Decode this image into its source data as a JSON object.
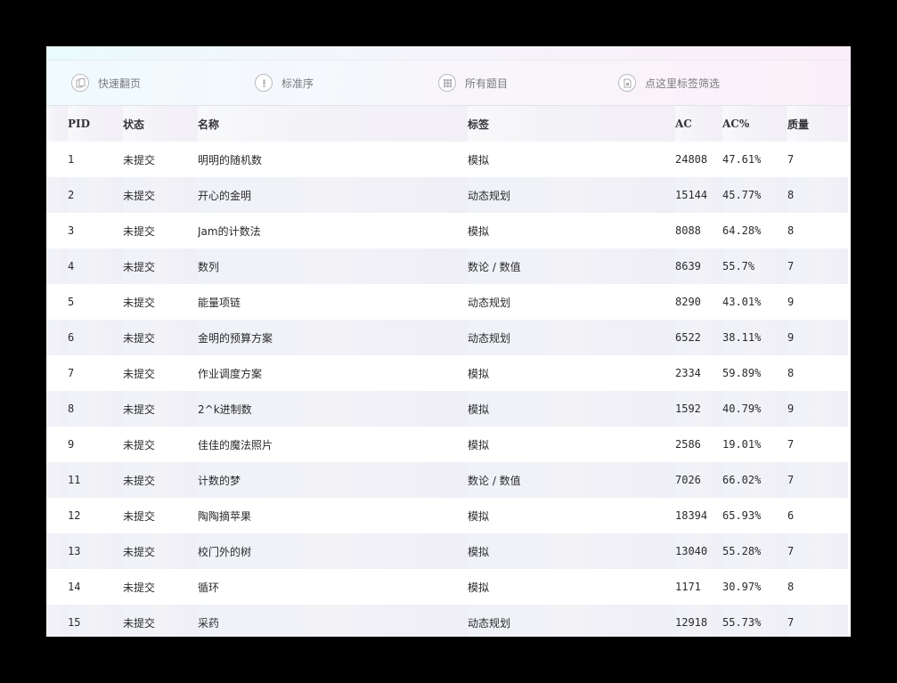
{
  "toolbar": {
    "items": [
      {
        "label": "快速翻页",
        "icon": "pages-icon"
      },
      {
        "label": "标准序",
        "icon": "info-icon"
      },
      {
        "label": "所有题目",
        "icon": "grid-icon"
      },
      {
        "label": "点这里标签筛选",
        "icon": "tag-icon"
      }
    ]
  },
  "table": {
    "headers": [
      "PID",
      "状态",
      "名称",
      "标签",
      "AC",
      "AC%",
      "质量"
    ],
    "rows": [
      {
        "pid": "1",
        "status": "未提交",
        "name": "明明的随机数",
        "tag": "模拟",
        "ac": "24808",
        "acp": "47.61%",
        "quality": "7"
      },
      {
        "pid": "2",
        "status": "未提交",
        "name": "开心的金明",
        "tag": "动态规划",
        "ac": "15144",
        "acp": "45.77%",
        "quality": "8"
      },
      {
        "pid": "3",
        "status": "未提交",
        "name": "Jam的计数法",
        "tag": "模拟",
        "ac": "8088",
        "acp": "64.28%",
        "quality": "8"
      },
      {
        "pid": "4",
        "status": "未提交",
        "name": "数列",
        "tag": "数论 / 数值",
        "ac": "8639",
        "acp": "55.7%",
        "quality": "7"
      },
      {
        "pid": "5",
        "status": "未提交",
        "name": "能量项链",
        "tag": "动态规划",
        "ac": "8290",
        "acp": "43.01%",
        "quality": "9"
      },
      {
        "pid": "6",
        "status": "未提交",
        "name": "金明的预算方案",
        "tag": "动态规划",
        "ac": "6522",
        "acp": "38.11%",
        "quality": "9"
      },
      {
        "pid": "7",
        "status": "未提交",
        "name": "作业调度方案",
        "tag": "模拟",
        "ac": "2334",
        "acp": "59.89%",
        "quality": "8"
      },
      {
        "pid": "8",
        "status": "未提交",
        "name": "2^k进制数",
        "tag": "模拟",
        "ac": "1592",
        "acp": "40.79%",
        "quality": "9"
      },
      {
        "pid": "9",
        "status": "未提交",
        "name": "佳佳的魔法照片",
        "tag": "模拟",
        "ac": "2586",
        "acp": "19.01%",
        "quality": "7"
      },
      {
        "pid": "11",
        "status": "未提交",
        "name": "计数的梦",
        "tag": "数论 / 数值",
        "ac": "7026",
        "acp": "66.02%",
        "quality": "7"
      },
      {
        "pid": "12",
        "status": "未提交",
        "name": "陶陶摘苹果",
        "tag": "模拟",
        "ac": "18394",
        "acp": "65.93%",
        "quality": "6"
      },
      {
        "pid": "13",
        "status": "未提交",
        "name": "校门外的树",
        "tag": "模拟",
        "ac": "13040",
        "acp": "55.28%",
        "quality": "7"
      },
      {
        "pid": "14",
        "status": "未提交",
        "name": "循环",
        "tag": "模拟",
        "ac": "1171",
        "acp": "30.97%",
        "quality": "8"
      },
      {
        "pid": "15",
        "status": "未提交",
        "name": "采药",
        "tag": "动态规划",
        "ac": "12918",
        "acp": "55.73%",
        "quality": "7"
      }
    ]
  }
}
